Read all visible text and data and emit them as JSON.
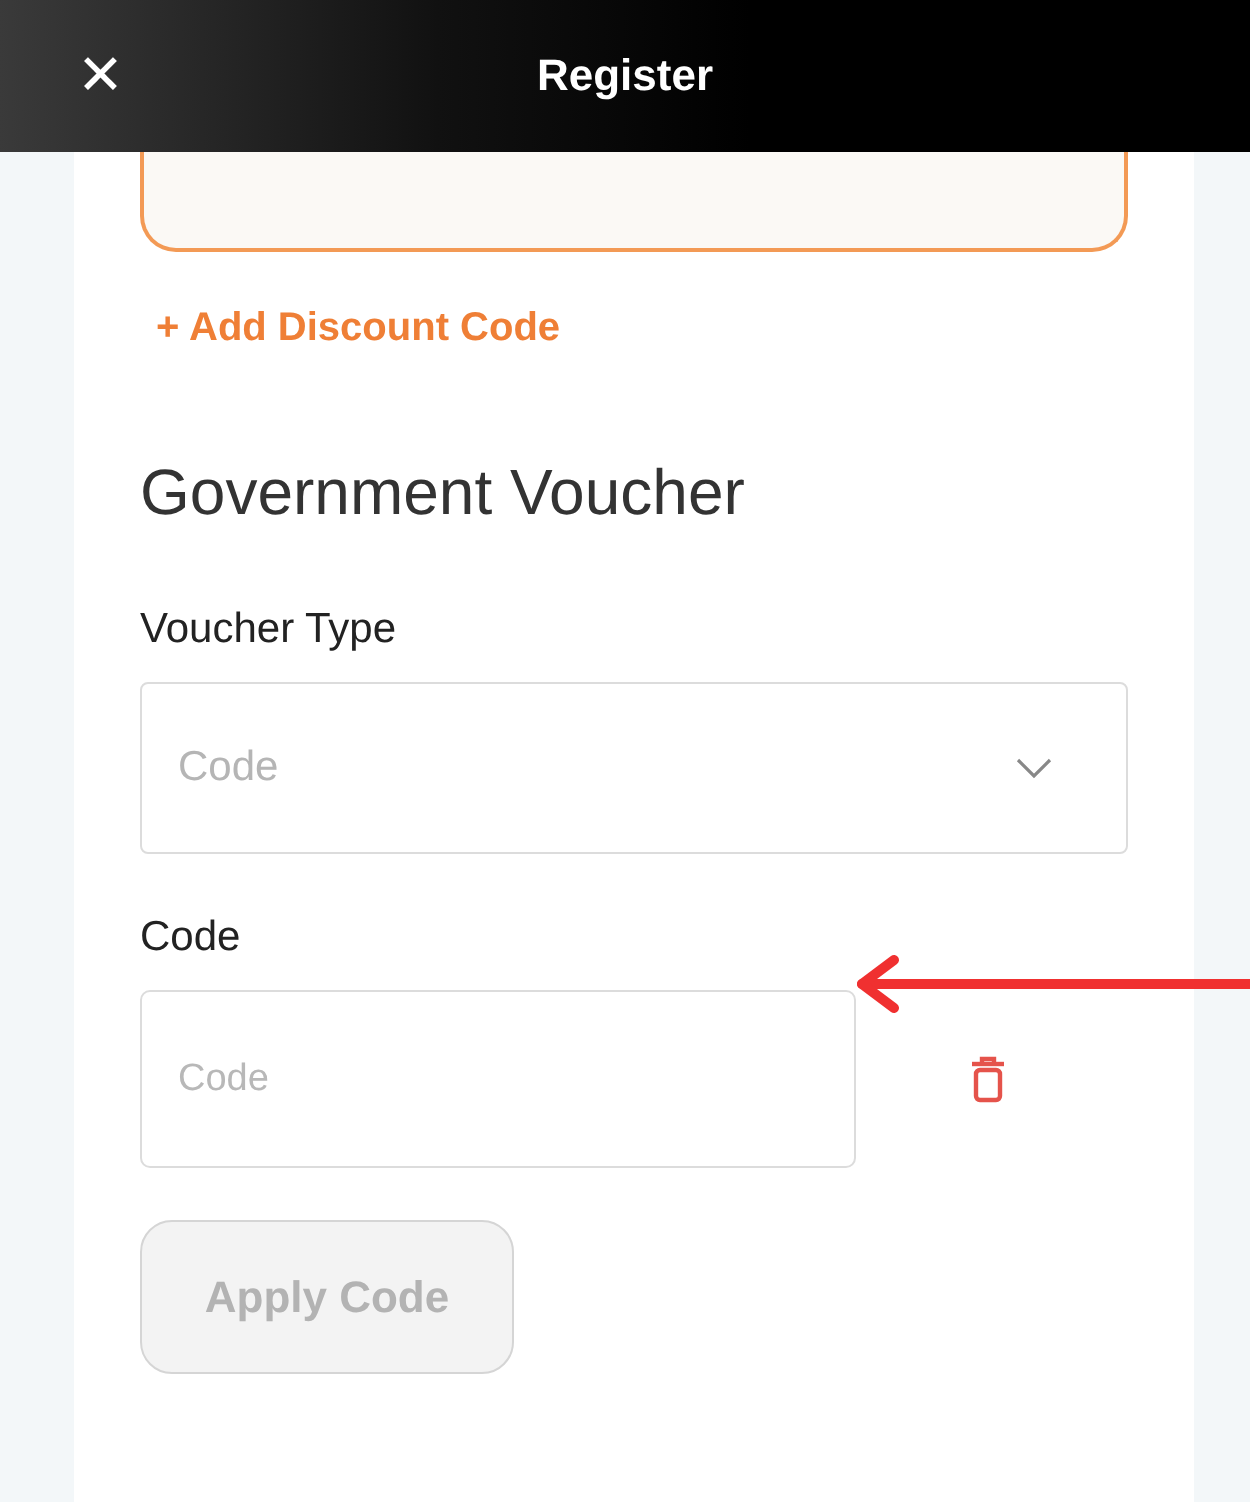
{
  "header": {
    "title": "Register",
    "close_icon": "✕"
  },
  "discount": {
    "link": "+ Add Discount Code"
  },
  "voucher": {
    "heading": "Government Voucher",
    "type_label": "Voucher Type",
    "type_placeholder": "Code",
    "code_label": "Code",
    "code_placeholder": "Code",
    "apply_button": {
      "label": "Apply Code",
      "disabled": true
    }
  },
  "pointer_arrow": true
}
